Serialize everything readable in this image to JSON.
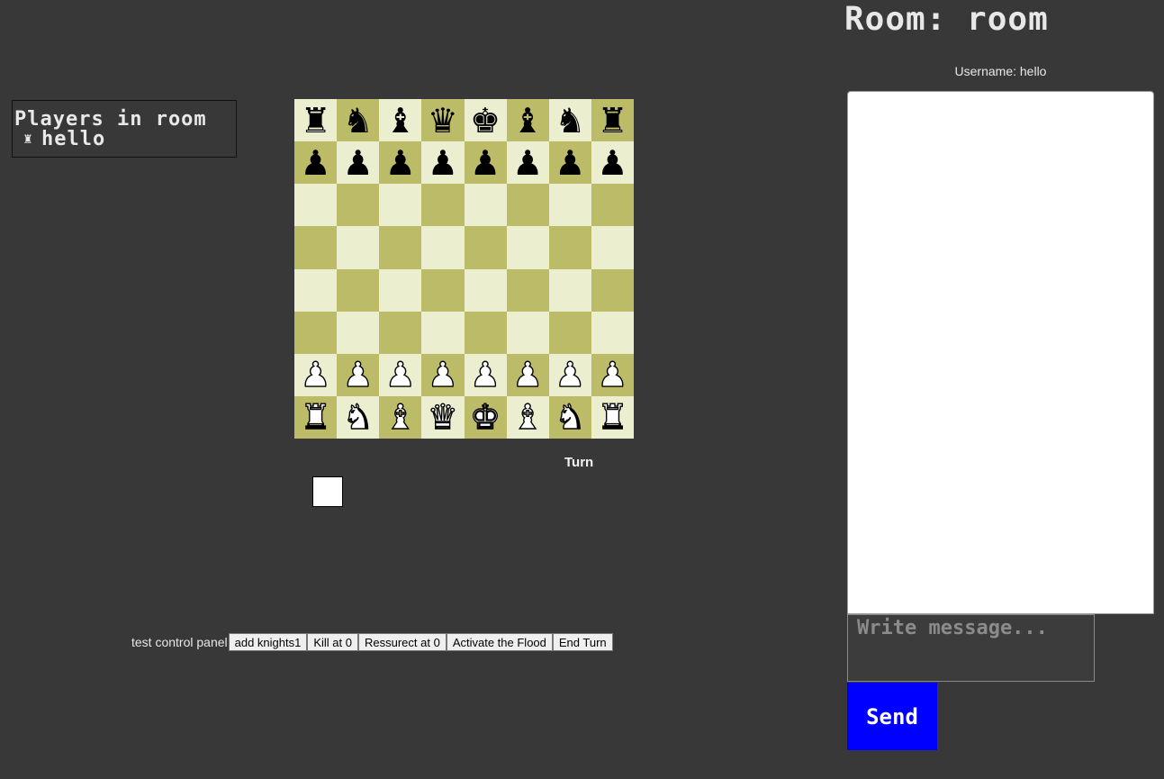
{
  "room": {
    "title": "Room: room",
    "username_line": "Username: hello"
  },
  "players_panel": {
    "title": "Players in room",
    "players": [
      {
        "icon": "chess-piece-icon",
        "glyph": "♜",
        "name": "hello"
      }
    ]
  },
  "board": {
    "light_color": "#ebefd0",
    "dark_color": "#bcbc68",
    "rows": [
      [
        {
          "glyph": "♜",
          "color": "black",
          "piece": "rook"
        },
        {
          "glyph": "♞",
          "color": "black",
          "piece": "knight"
        },
        {
          "glyph": "♝",
          "color": "black",
          "piece": "bishop"
        },
        {
          "glyph": "♛",
          "color": "black",
          "piece": "queen"
        },
        {
          "glyph": "♚",
          "color": "black",
          "piece": "king"
        },
        {
          "glyph": "♝",
          "color": "black",
          "piece": "bishop"
        },
        {
          "glyph": "♞",
          "color": "black",
          "piece": "knight"
        },
        {
          "glyph": "♜",
          "color": "black",
          "piece": "rook"
        }
      ],
      [
        {
          "glyph": "♟",
          "color": "black",
          "piece": "pawn"
        },
        {
          "glyph": "♟",
          "color": "black",
          "piece": "pawn"
        },
        {
          "glyph": "♟",
          "color": "black",
          "piece": "pawn"
        },
        {
          "glyph": "♟",
          "color": "black",
          "piece": "pawn"
        },
        {
          "glyph": "♟",
          "color": "black",
          "piece": "pawn"
        },
        {
          "glyph": "♟",
          "color": "black",
          "piece": "pawn"
        },
        {
          "glyph": "♟",
          "color": "black",
          "piece": "pawn"
        },
        {
          "glyph": "♟",
          "color": "black",
          "piece": "pawn"
        }
      ],
      [
        null,
        null,
        null,
        null,
        null,
        null,
        null,
        null
      ],
      [
        null,
        null,
        null,
        null,
        null,
        null,
        null,
        null
      ],
      [
        null,
        null,
        null,
        null,
        null,
        null,
        null,
        null
      ],
      [
        null,
        null,
        null,
        null,
        null,
        null,
        null,
        null
      ],
      [
        {
          "glyph": "♟",
          "color": "white",
          "piece": "pawn"
        },
        {
          "glyph": "♟",
          "color": "white",
          "piece": "pawn"
        },
        {
          "glyph": "♟",
          "color": "white",
          "piece": "pawn"
        },
        {
          "glyph": "♟",
          "color": "white",
          "piece": "pawn"
        },
        {
          "glyph": "♟",
          "color": "white",
          "piece": "pawn"
        },
        {
          "glyph": "♟",
          "color": "white",
          "piece": "pawn"
        },
        {
          "glyph": "♟",
          "color": "white",
          "piece": "pawn"
        },
        {
          "glyph": "♟",
          "color": "white",
          "piece": "pawn"
        }
      ],
      [
        {
          "glyph": "♜",
          "color": "white",
          "piece": "rook"
        },
        {
          "glyph": "♞",
          "color": "white",
          "piece": "knight"
        },
        {
          "glyph": "♝",
          "color": "white",
          "piece": "bishop"
        },
        {
          "glyph": "♛",
          "color": "white",
          "piece": "queen"
        },
        {
          "glyph": "♚",
          "color": "white",
          "piece": "king"
        },
        {
          "glyph": "♝",
          "color": "white",
          "piece": "bishop"
        },
        {
          "glyph": "♞",
          "color": "white",
          "piece": "knight"
        },
        {
          "glyph": "♜",
          "color": "white",
          "piece": "rook"
        }
      ]
    ]
  },
  "turn": {
    "label": "Turn",
    "current_color": "#ffffff"
  },
  "control_panel": {
    "label": "test control panel",
    "buttons": [
      {
        "name": "add-knights-button",
        "label": "add knights1"
      },
      {
        "name": "kill-button",
        "label": "Kill at 0"
      },
      {
        "name": "resurrect-button",
        "label": "Ressurect at 0"
      },
      {
        "name": "activate-flood-button",
        "label": "Activate the Flood"
      },
      {
        "name": "end-turn-button",
        "label": "End Turn"
      }
    ]
  },
  "chat": {
    "input_value": "",
    "input_placeholder": "Write message...",
    "send_label": "Send",
    "send_color": "#0000ff"
  }
}
